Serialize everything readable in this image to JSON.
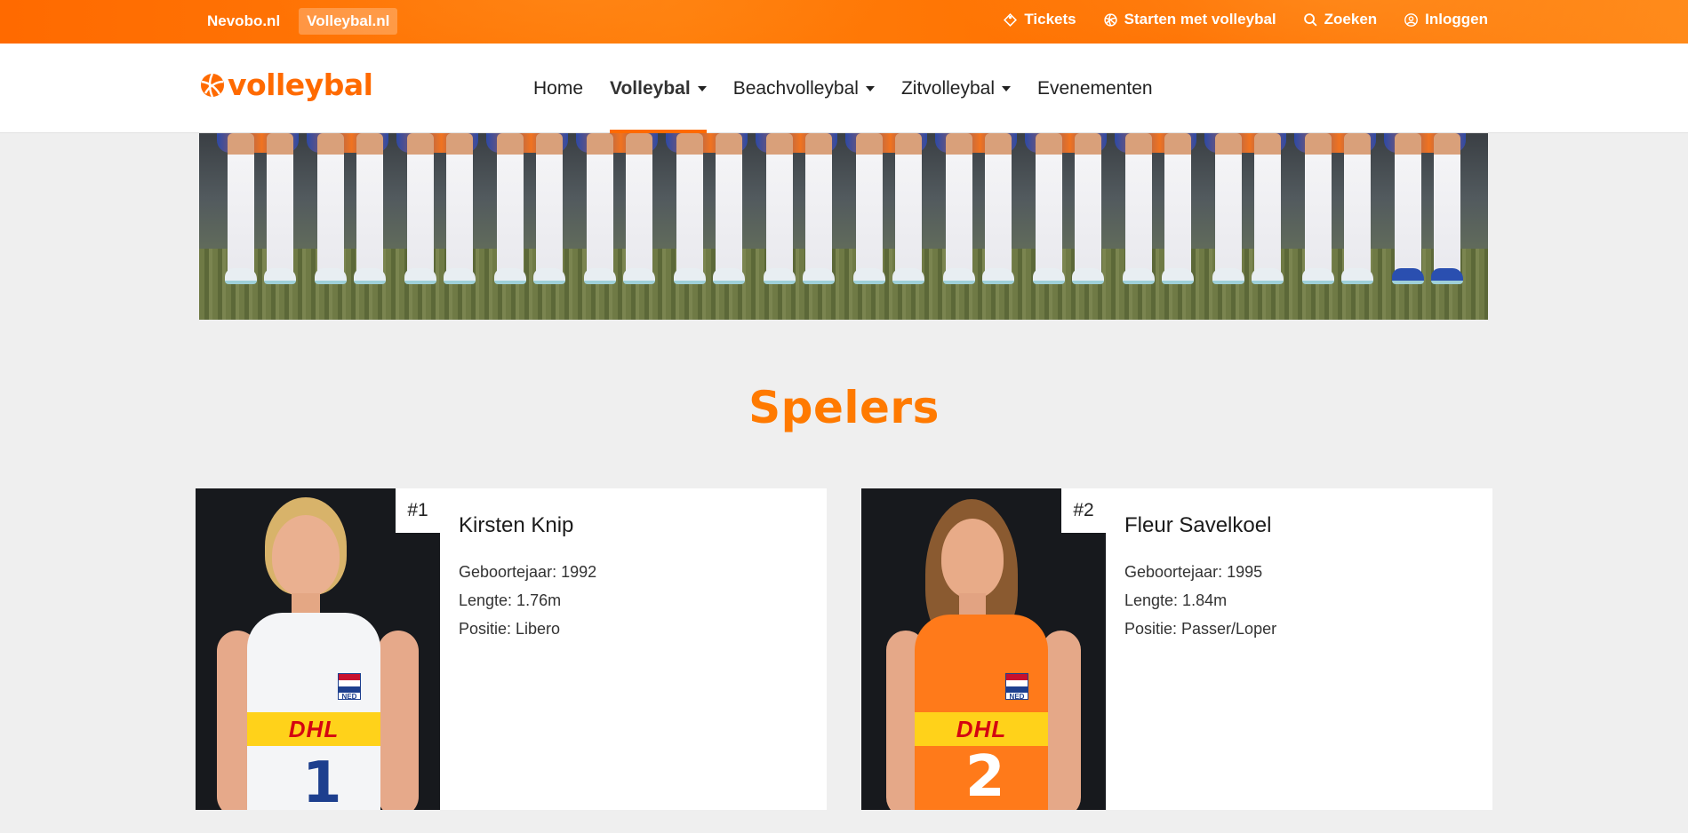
{
  "topbar": {
    "left_links": [
      {
        "label": "Nevobo.nl",
        "active": false
      },
      {
        "label": "Volleybal.nl",
        "active": true
      }
    ],
    "right_links": [
      {
        "label": "Tickets",
        "icon": "ticket-icon"
      },
      {
        "label": "Starten met volleybal",
        "icon": "volleyball-icon"
      },
      {
        "label": "Zoeken",
        "icon": "search-icon"
      },
      {
        "label": "Inloggen",
        "icon": "user-circle-icon"
      }
    ]
  },
  "logo": {
    "text": "volleybal"
  },
  "nav": {
    "items": [
      {
        "label": "Home",
        "dropdown": false,
        "active": false
      },
      {
        "label": "Volleybal",
        "dropdown": true,
        "active": true
      },
      {
        "label": "Beachvolleybal",
        "dropdown": true,
        "active": false
      },
      {
        "label": "Zitvolleybal",
        "dropdown": true,
        "active": false
      },
      {
        "label": "Evenementen",
        "dropdown": false,
        "active": false
      }
    ]
  },
  "section": {
    "title": "Spelers"
  },
  "players": [
    {
      "number": "#1",
      "name": "Kirsten Knip",
      "birth_year": "Geboortejaar: 1992",
      "height": "Lengte: 1.76m",
      "position": "Positie: Libero",
      "shirt_color": "white",
      "flag_text": "NED",
      "sponsor": "DHL",
      "shirt_number": "1"
    },
    {
      "number": "#2",
      "name": "Fleur Savelkoel",
      "birth_year": "Geboortejaar: 1995",
      "height": "Lengte: 1.84m",
      "position": "Positie: Passer/Loper",
      "shirt_color": "orange",
      "flag_text": "NED",
      "sponsor": "DHL",
      "shirt_number": "2"
    }
  ],
  "colors": {
    "accent": "#ff6a00",
    "title": "#ff7a00",
    "background": "#efefef"
  }
}
